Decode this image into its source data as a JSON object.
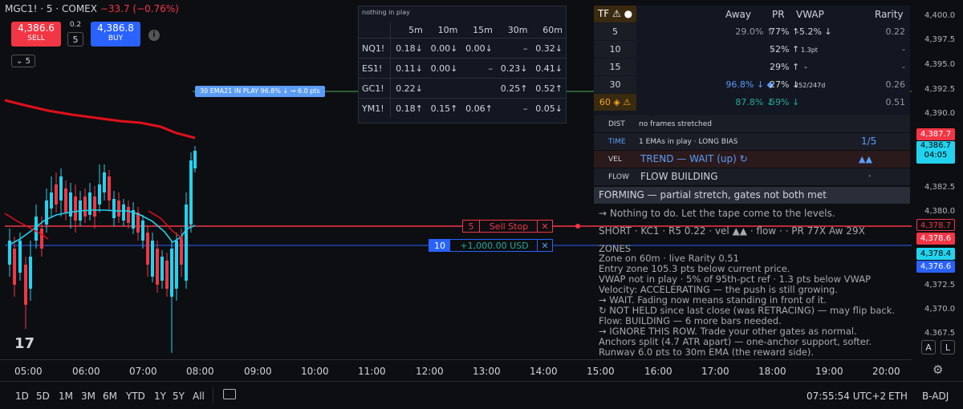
{
  "header": {
    "symbol": "MGC1! · 5 · COMEX",
    "change": "−33.7 (−0.76%)",
    "sell_price": "4,386.6",
    "sell_label": "SELL",
    "buy_price": "4,386.8",
    "buy_label": "BUY",
    "spread": "0.2",
    "quantity": "5",
    "collapse_label": "⌄ 5"
  },
  "matrix": {
    "title": "nothing in play",
    "columns": [
      "5m",
      "10m",
      "15m",
      "30m",
      "60m"
    ],
    "rows": [
      {
        "symbol": "NQ1!",
        "cells": [
          "0.18↓",
          "0.00↓",
          "0.00↓",
          "–",
          "0.32↓"
        ]
      },
      {
        "symbol": "ES1!",
        "cells": [
          "0.11↓",
          "0.00↓",
          "–",
          "0.23↓",
          "0.41↓"
        ]
      },
      {
        "symbol": "GC1!",
        "cells": [
          "0.22↓",
          "",
          "",
          "0.25↑",
          "0.52↑"
        ]
      },
      {
        "symbol": "YM1!",
        "cells": [
          "0.18↑",
          "0.15↑",
          "0.06↑",
          "–",
          "0.05↓"
        ]
      }
    ]
  },
  "panel": {
    "headers": {
      "tf": "TF ⚠ ●",
      "away": "Away",
      "pr": "PR",
      "vwap": "VWAP",
      "rarity": "Rarity"
    },
    "tf_rows": [
      {
        "tf": "5",
        "away": "29.0% ↑",
        "pr": "77% ↑",
        "vwap": "-5.2% ↓",
        "rarity": "0.22"
      },
      {
        "tf": "10",
        "away": "-",
        "pr": "52% ↑",
        "vwap": "1.3pt",
        "rarity": "-"
      },
      {
        "tf": "15",
        "away": "-",
        "pr": "29% ↑",
        "vwap": "-",
        "rarity": "-"
      },
      {
        "tf": "30",
        "away": "96.8% ↓ ◆",
        "pr": "27% ↓",
        "vwap": "252/247d",
        "rarity": "0.26"
      },
      {
        "tf": "60 ◈ ⚠",
        "away": "87.8% ↓",
        "pr": "59% ↓",
        "vwap": "",
        "rarity": "0.51"
      }
    ],
    "dist_label": "DIST",
    "dist_value": "no frames stretched",
    "time_label": "TIME",
    "time_value": "1 EMAs in play · LONG BIAS",
    "time_count": "1/5",
    "vel_label": "VEL",
    "vel_value": "TREND — WAIT  (up)  ↻",
    "vel_arrows": "▲▲",
    "flow_label": "FLOW",
    "flow_value": "FLOW BUILDING",
    "flow_mark": "·",
    "forming": "FORMING — partial stretch, gates not both met",
    "notes": [
      "→ Nothing to do. Let the tape come to the levels.",
      "SHORT · KC1 · R5 0.22 · vel ▲▲ · flow · · PR 77X Aw 29X",
      "ZONES",
      "Zone on 60m · live Rarity 0.51",
      "Entry zone 105.3 pts below current price.",
      "VWAP not in play · 5% of 95th-pct ref · 1.3 pts below VWAP",
      "Velocity: ACCELERATING — the push is still growing.",
      "  → WAIT. Fading now means standing in front of it.",
      "  ↻ NOT HELD since last close (was RETRACING) — may flip back.",
      "Flow: BUILDING — 6 more bars needed.",
      "  → IGNORE THIS ROW. Trade your other gates as normal.",
      "Anchors split (4.7 ATR apart) — one-anchor support, softer.",
      "Runway 6.0 pts to 30m EMA (the reward side)."
    ]
  },
  "chart_labels": {
    "ema_tag": "30 EMA21  IN PLAY  96.8% ↓   → 6.0 pts",
    "sell_stop_qty": "5",
    "sell_stop_label": "Sell Stop",
    "position_qty": "10",
    "position_pnl": "+1,000.00 USD",
    "close_x": "✕"
  },
  "price_axis": {
    "labels": [
      "4,400.0",
      "4,397.5",
      "4,395.0",
      "4,392.5",
      "4,390.0",
      "4,382.5",
      "4,380.0",
      "4,372.5",
      "4,370.0",
      "4,367.5"
    ],
    "tag_red_top": "4,387.7",
    "tag_last": "4,386.7",
    "tag_countdown": "04:05",
    "tag_stop": "4,378.7",
    "tag_stop2": "4,378.6",
    "tag_blue1": "4,378.4",
    "tag_blue2": "4,376.6",
    "a_label": "A",
    "l_label": "L"
  },
  "time_axis": [
    "05:00",
    "06:00",
    "07:00",
    "08:00",
    "09:00",
    "10:00",
    "11:00",
    "12:00",
    "13:00",
    "14:00",
    "15:00",
    "16:00",
    "17:00",
    "18:00",
    "19:00",
    "20:00"
  ],
  "bottom_bar": {
    "ranges": [
      "1D",
      "5D",
      "1M",
      "3M",
      "6M",
      "YTD",
      "1Y",
      "5Y",
      "All"
    ],
    "clock": "07:55:54 UTC+2",
    "session": "ETH",
    "adj": "B-ADJ"
  },
  "colors": {
    "up": "#22d3ee",
    "down": "#f23645",
    "ema": "#e0101a",
    "fast": "#22d3ee",
    "green_line": "#26a69a",
    "blue_line": "#2962ff"
  }
}
